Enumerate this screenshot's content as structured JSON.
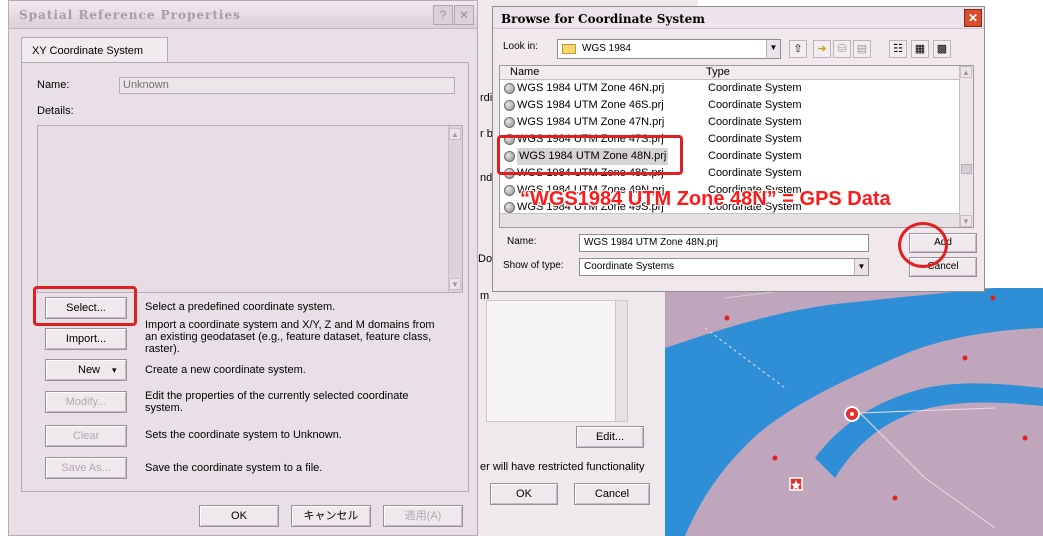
{
  "spatial_dialog": {
    "title": "Spatial Reference Properties",
    "help_label": "?",
    "close_label": "✕",
    "tab_label": "XY Coordinate System",
    "name_label": "Name:",
    "name_value": "Unknown",
    "details_label": "Details:",
    "buttons": [
      {
        "label": "Select...",
        "description": "Select a predefined coordinate system.",
        "enabled": true
      },
      {
        "label": "Import...",
        "description": "Import a coordinate system and X/Y, Z and M domains from an existing geodataset (e.g., feature dataset, feature class, raster).",
        "enabled": true
      },
      {
        "label": "New",
        "description": "Create a new coordinate system.",
        "enabled": true
      },
      {
        "label": "Modify...",
        "description": "Edit the properties of the currently selected coordinate system.",
        "enabled": false
      },
      {
        "label": "Clear",
        "description": "Sets the coordinate system to Unknown.",
        "enabled": false
      },
      {
        "label": "Save As...",
        "description": "Save the coordinate system to a file.",
        "enabled": false
      }
    ],
    "new_arrow": "▾",
    "footer": {
      "ok": "OK",
      "cancel": "キャンセル",
      "apply": "適用(A)"
    }
  },
  "background_window": {
    "edge_labels": [
      "rdi",
      "r b",
      "nd",
      "Doc",
      "m"
    ],
    "edit_label": "Edit...",
    "warning_text": "er will have restricted functionality",
    "ok": "OK",
    "cancel": "Cancel"
  },
  "browse_dialog": {
    "title": "Browse for Coordinate System",
    "close_label": "✕",
    "look_in_label": "Look in:",
    "look_in_value": "WGS 1984",
    "columns": {
      "name": "Name",
      "type": "Type"
    },
    "rows": [
      {
        "name": "WGS 1984 UTM Zone 46N.prj",
        "type": "Coordinate System"
      },
      {
        "name": "WGS 1984 UTM Zone 46S.prj",
        "type": "Coordinate System"
      },
      {
        "name": "WGS 1984 UTM Zone 47N.prj",
        "type": "Coordinate System"
      },
      {
        "name": "WGS 1984 UTM Zone 47S.prj",
        "type": "Coordinate System"
      },
      {
        "name": "WGS 1984 UTM Zone 48N.prj",
        "type": "Coordinate System"
      },
      {
        "name": "WGS 1984 UTM Zone 48S.prj",
        "type": "Coordinate System"
      },
      {
        "name": "WGS 1984 UTM Zone 49N.prj",
        "type": "Coordinate System"
      },
      {
        "name": "WGS 1984 UTM Zone 49S.prj",
        "type": "Coordinate System"
      }
    ],
    "selected_row": 4,
    "name_label": "Name:",
    "name_value": "WGS 1984 UTM Zone 48N.prj",
    "type_label": "Show of type:",
    "type_value": "Coordinate Systems",
    "add_label": "Add",
    "cancel_label": "Cancel"
  },
  "annotation": {
    "text": "“WGS1984 UTM Zone 48N” = GPS Data",
    "color": "#ff1a1a"
  },
  "colors": {
    "dialog_bg": "#e9dfe6",
    "map_land": "#bfa6bc",
    "map_water": "#2f8fd6",
    "highlight_red": "#e02020"
  }
}
